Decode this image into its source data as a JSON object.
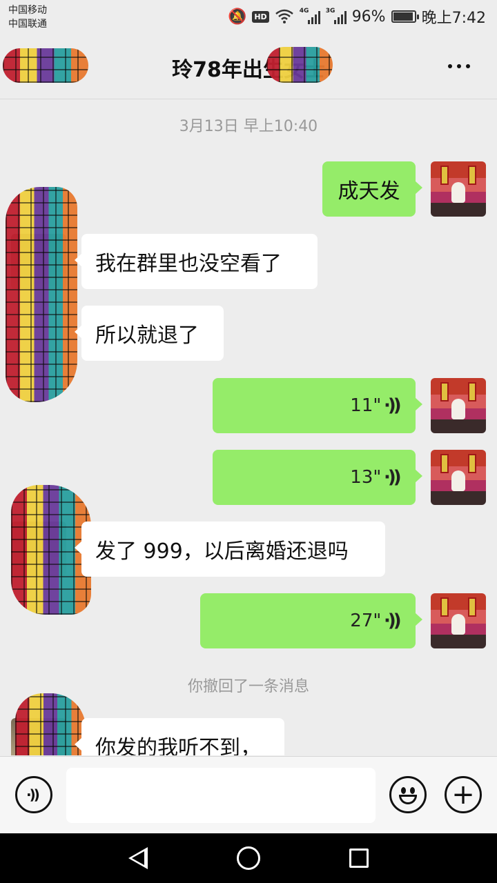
{
  "status_bar": {
    "carrier_1": "中国移动",
    "carrier_2": "中国联通",
    "hd_badge": "HD",
    "network_1": "4G",
    "network_2": "3G",
    "battery": "96%",
    "time": "晚上7:42"
  },
  "header": {
    "title": "玲78年出生女士",
    "more_icon": "more-dots-icon"
  },
  "chat": {
    "timestamp": "3月13日 早上10:40",
    "messages": [
      {
        "from": "me",
        "type": "text",
        "text": "成天发"
      },
      {
        "from": "them",
        "type": "text",
        "text": "我在群里也没空看了"
      },
      {
        "from": "them",
        "type": "text",
        "text": "所以就退了"
      },
      {
        "from": "me",
        "type": "voice",
        "duration": "11\"",
        "icon": "voice-wave-icon"
      },
      {
        "from": "me",
        "type": "voice",
        "duration": "13\"",
        "icon": "voice-wave-icon"
      },
      {
        "from": "them",
        "type": "text",
        "text": "发了 999，以后离婚还退吗"
      },
      {
        "from": "me",
        "type": "voice",
        "duration": "27\"",
        "icon": "voice-wave-icon"
      },
      {
        "from": "system",
        "type": "notice",
        "text": "你撤回了一条消息"
      },
      {
        "from": "them",
        "type": "text",
        "text": "你发的我听不到，"
      }
    ]
  },
  "input_bar": {
    "voice_icon": "voice-input-icon",
    "text_value": "",
    "emoji_icon": "emoji-icon",
    "plus_icon": "plus-icon",
    "plus_glyph": "+",
    "voice_glyph": "((·"
  },
  "nav_bar": {
    "back_icon": "back-triangle-icon",
    "home_icon": "home-circle-icon",
    "recent_icon": "recent-square-icon"
  }
}
